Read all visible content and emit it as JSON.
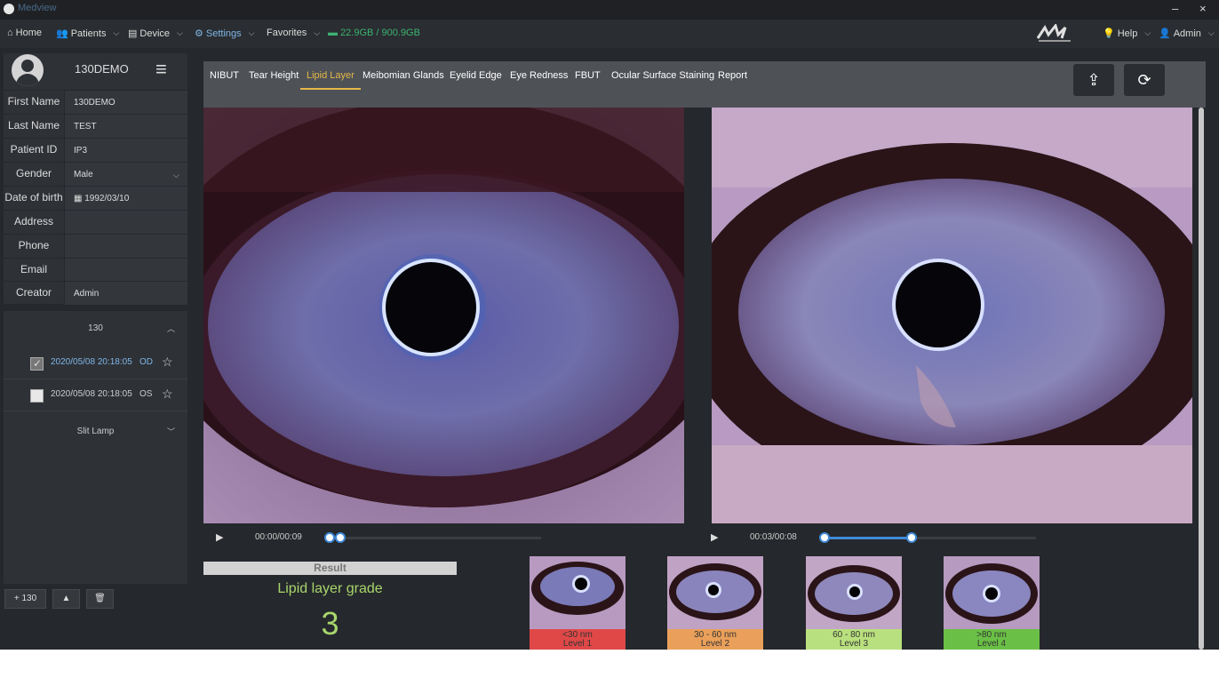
{
  "app": {
    "title": "Medview"
  },
  "window": {
    "minimize": "–",
    "close": "×"
  },
  "menu": {
    "home": "Home",
    "patients": "Patients",
    "device": "Device",
    "settings": "Settings",
    "favorites": "Favorites",
    "storage": "22.9GB / 900.9GB",
    "help": "Help",
    "admin": "Admin"
  },
  "patient": {
    "header_name": "130DEMO",
    "fields": [
      {
        "label": "First Name",
        "value": "130DEMO"
      },
      {
        "label": "Last Name",
        "value": "TEST"
      },
      {
        "label": "Patient ID",
        "value": "IP3"
      },
      {
        "label": "Gender",
        "value": "Male"
      },
      {
        "label": "Date of birth",
        "value": "1992/03/10"
      },
      {
        "label": "Address",
        "value": ""
      },
      {
        "label": "Phone",
        "value": ""
      },
      {
        "label": "Email",
        "value": ""
      },
      {
        "label": "Creator",
        "value": "Admin"
      }
    ]
  },
  "records": {
    "group": "130",
    "items": [
      {
        "date": "2020/05/08 20:18:05",
        "eye": "OD",
        "checked": true
      },
      {
        "date": "2020/05/08 20:18:05",
        "eye": "OS",
        "checked": false
      }
    ],
    "group2": "Slit Lamp"
  },
  "bottom_buttons": {
    "add": "+ 130",
    "up": "▲",
    "delete": "🗑"
  },
  "tabs": [
    "NIBUT",
    "Tear Height",
    "Lipid Layer",
    "Meibomian Glands",
    "Eyelid Edge",
    "Eye Redness",
    "FBUT",
    "Ocular Surface Staining",
    "Report"
  ],
  "players": {
    "left": {
      "time": "00:00/00:09"
    },
    "right": {
      "time": "00:03/00:08"
    }
  },
  "result": {
    "header": "Result",
    "title": "Lipid layer grade",
    "value": "3"
  },
  "levels": [
    {
      "range": "<30 nm",
      "level": "Level 1",
      "color": "#e04848"
    },
    {
      "range": "30 - 60 nm",
      "level": "Level 2",
      "color": "#eaa05a"
    },
    {
      "range": "60 - 80 nm",
      "level": "Level 3",
      "color": "#b9e07e"
    },
    {
      "range": ">80 nm",
      "level": "Level 4",
      "color": "#6ac046"
    }
  ],
  "colors": {
    "accent": "#7fb6e6",
    "active_tab": "#e6b84a",
    "result_green": "#a8d66c",
    "storage_green": "#3cb371"
  }
}
